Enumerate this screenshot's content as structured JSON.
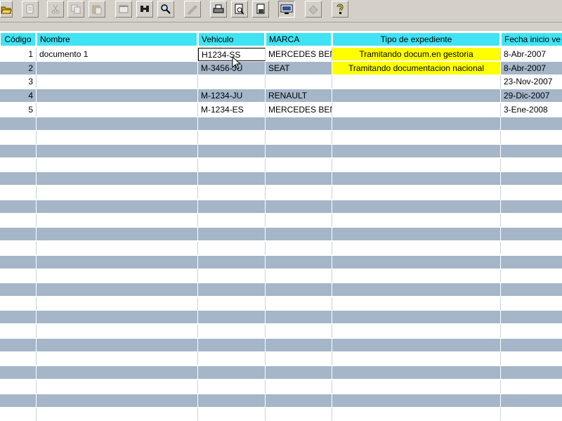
{
  "toolbar": {
    "buttons": [
      {
        "icon": "open-folder-icon"
      },
      {
        "icon": "export-icon"
      },
      {
        "icon": "cut-icon"
      },
      {
        "icon": "copy-icon"
      },
      {
        "icon": "paste-icon"
      },
      {
        "icon": "window-icon"
      },
      {
        "icon": "binoculars-icon"
      },
      {
        "icon": "search-icon"
      },
      {
        "icon": "edit-icon"
      },
      {
        "icon": "print-icon"
      },
      {
        "icon": "print-preview-icon"
      },
      {
        "icon": "page-setup-icon"
      },
      {
        "icon": "monitor-icon"
      },
      {
        "icon": "eraser-icon"
      },
      {
        "icon": "help-icon"
      }
    ]
  },
  "grid": {
    "columns": [
      "Código",
      "Nombre",
      "Vehiculo",
      "MARCA",
      "Tipo de expediente",
      "Fecha inicio ve"
    ],
    "rows": [
      {
        "codigo": "1",
        "nombre": "documento 1",
        "vehiculo": "H1234-SS",
        "marca": "MERCEDES BEN",
        "tipo": "Tramitando docum.en gestoria",
        "fecha": "8-Abr-2007"
      },
      {
        "codigo": "2",
        "nombre": "",
        "vehiculo": "M-3456-JU",
        "marca": "SEAT",
        "tipo": "Tramitando documentacion nacional",
        "fecha": "8-Abr-2007"
      },
      {
        "codigo": "3",
        "nombre": "",
        "vehiculo": "",
        "marca": "",
        "tipo": "",
        "fecha": "23-Nov-2007"
      },
      {
        "codigo": "4",
        "nombre": "",
        "vehiculo": "M-1234-JU",
        "marca": "RENAULT",
        "tipo": "",
        "fecha": "29-Dic-2007"
      },
      {
        "codigo": "5",
        "nombre": "",
        "vehiculo": "M-1234-ES",
        "marca": "MERCEDES BEN",
        "tipo": "",
        "fecha": "3-Ene-2008"
      }
    ],
    "header_color": "#3fe3f3",
    "stripe_color": "#a4b6c8",
    "highlight_color": "#ffff00"
  }
}
